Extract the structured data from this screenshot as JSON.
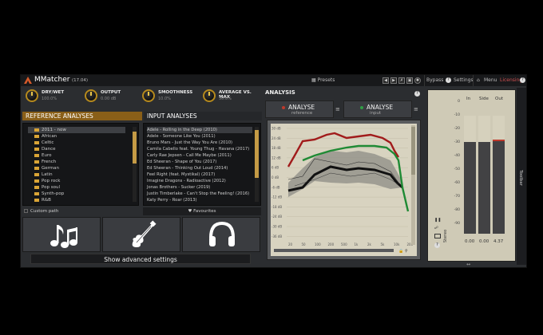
{
  "app": {
    "name": "MMatcher",
    "version": "(17.04)"
  },
  "titlebar": {
    "presets": "Presets",
    "bypass": "Bypass",
    "settings": "Settings",
    "menu": "Menu",
    "licensing": "Licensing"
  },
  "knobs": [
    {
      "label": "DRY/WET",
      "value": "100.0%",
      "level": 1.0
    },
    {
      "label": "OUTPUT",
      "value": "0.00 dB",
      "level": 0.5
    },
    {
      "label": "SMOOTHNESS",
      "value": "10.0%",
      "level": 0.1
    },
    {
      "label": "AVERAGE VS. MAX",
      "value": "50.0%",
      "level": 0.5
    }
  ],
  "reference": {
    "header": "REFERENCE ANALYSES",
    "tree": [
      "2011 - now",
      "African",
      "Celtic",
      "Dance",
      "Euro",
      "French",
      "German",
      "Latin",
      "Pop rock",
      "Pop soul",
      "Synth-pop",
      "R&B"
    ],
    "custom_path": "Custom path"
  },
  "input": {
    "header": "INPUT ANALYSES",
    "items": [
      "Adele - Rolling in the Deep (2010)",
      "Adele - Someone Like You (2011)",
      "Bruno Mars - Just the Way You Are (2010)",
      "Camila Cabello feat. Young Thug - Havana (2017)",
      "Carly Rae Jepsen - Call Me Maybe (2011)",
      "Ed Sheeran - Shape of You (2017)",
      "Ed Sheeran - Thinking Out Loud (2014)",
      "Feel Right (feat. Mystikal) (2017)",
      "Imagine Dragons - Radioactive (2012)",
      "Jonas Brothers - Sucker (2019)",
      "Justin Timberlake - Can't Stop the Feeling! (2016)",
      "Katy Perry - Roar (2013)"
    ],
    "favourites": "Favourites"
  },
  "category_buttons": [
    "music-notes",
    "guitar",
    "headphones"
  ],
  "advanced": "Show advanced settings",
  "analysis": {
    "title": "ANALYSIS",
    "ref_btn": {
      "label": "ANALYSE",
      "sub": "reference",
      "color": "#c0392b"
    },
    "in_btn": {
      "label": "ANALYSE",
      "sub": "input",
      "color": "#2f9e44"
    },
    "y_ticks": [
      "30 dB",
      "24 dB",
      "18 dB",
      "12 dB",
      "6 dB",
      "0 dB",
      "-6 dB",
      "-12 dB",
      "-18 dB",
      "-24 dB",
      "-30 dB",
      "-36 dB"
    ],
    "x_ticks": [
      "20",
      "50",
      "100",
      "200",
      "500",
      "1k",
      "2k",
      "5k",
      "10k",
      "20k"
    ]
  },
  "meter": {
    "headers": [
      "In",
      "Side",
      "Out"
    ],
    "ticks": [
      "0",
      "-10",
      "-20",
      "-30",
      "-40",
      "-50",
      "-60",
      "-70",
      "-80",
      "-90"
    ],
    "values": [
      "0.00",
      "0.00",
      "4.37"
    ],
    "levels": [
      0.78,
      0.78,
      0.8
    ],
    "stereo_label": "Stereo",
    "toolbar": "Toolbar"
  }
}
